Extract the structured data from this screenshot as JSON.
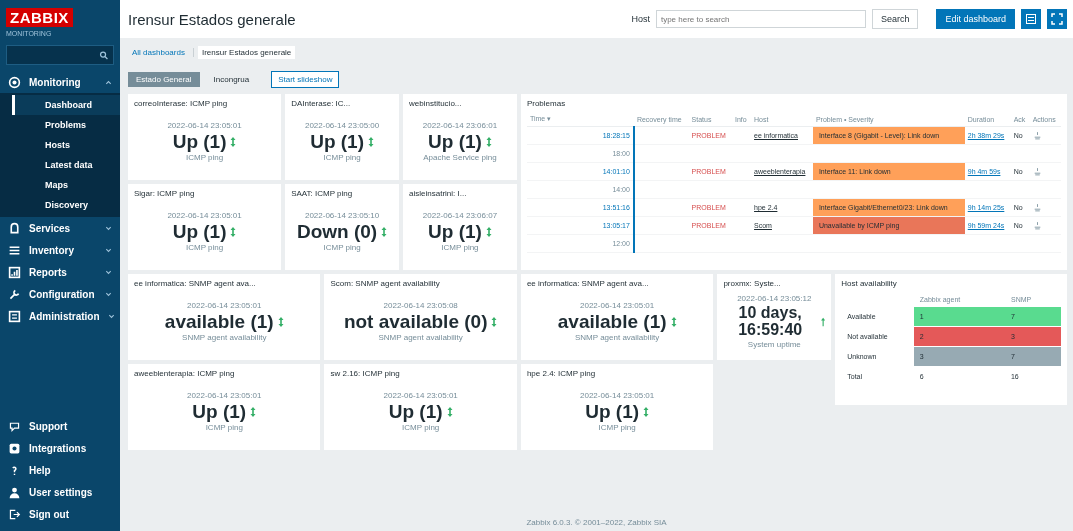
{
  "sidebar": {
    "logo": "ZABBIX",
    "server": "MONITORING",
    "items": [
      {
        "label": "Monitoring",
        "expanded": true,
        "children": [
          {
            "label": "Dashboard",
            "selected": true
          },
          {
            "label": "Problems",
            "selected": false
          },
          {
            "label": "Hosts",
            "selected": false
          },
          {
            "label": "Latest data",
            "selected": false
          },
          {
            "label": "Maps",
            "selected": false
          },
          {
            "label": "Discovery",
            "selected": false
          }
        ]
      },
      {
        "label": "Services",
        "expanded": false
      },
      {
        "label": "Inventory",
        "expanded": false
      },
      {
        "label": "Reports",
        "expanded": false
      },
      {
        "label": "Configuration",
        "expanded": false
      },
      {
        "label": "Administration",
        "expanded": false
      }
    ],
    "bottom": [
      {
        "label": "Support"
      },
      {
        "label": "Integrations"
      },
      {
        "label": "Help"
      },
      {
        "label": "User settings"
      },
      {
        "label": "Sign out"
      }
    ]
  },
  "header": {
    "title": "Irensur Estados generale",
    "host_label": "Host",
    "host_placeholder": "type here to search",
    "search_button": "Search",
    "edit_button": "Edit dashboard"
  },
  "breadcrumbs": [
    "All dashboards",
    "Irensur Estados generale"
  ],
  "pages": [
    {
      "label": "Estado General",
      "selected": true
    },
    {
      "label": "Incongrua",
      "selected": false
    }
  ],
  "slideshow_button": "Start slideshow",
  "widgets": [
    {
      "kind": "item",
      "title": "correoInterase: ICMP ping",
      "time": "2022-06-14 23:05:01",
      "value": "Up (1)",
      "description": "ICMP ping"
    },
    {
      "kind": "item",
      "title": "DAInterase: IC...",
      "time": "2022-06-14 23:05:00",
      "value": "Up (1)",
      "description": "ICMP ping"
    },
    {
      "kind": "item",
      "title": "webinstitucio...",
      "time": "2022-06-14 23:06:01",
      "value": "Up (1)",
      "description": "Apache Service ping"
    },
    {
      "kind": "problems"
    },
    {
      "kind": "item",
      "title": "Sigar: ICMP ping",
      "time": "2022-06-14 23:05:01",
      "value": "Up (1)",
      "description": "ICMP ping"
    },
    {
      "kind": "item",
      "title": "SAAT: ICMP ping",
      "time": "2022-06-14 23:05:10",
      "value": "Down (0)",
      "description": "ICMP ping"
    },
    {
      "kind": "item",
      "title": "aisleinsatrini: I...",
      "time": "2022-06-14 23:06:07",
      "value": "Up (1)",
      "description": "ICMP ping"
    },
    {
      "kind": "item",
      "title": "ee informatica: SNMP agent ava...",
      "time": "2022-06-14 23:05:01",
      "value": "available (1)",
      "description": "SNMP agent availability"
    },
    {
      "kind": "item",
      "title": "Scom: SNMP agent availability",
      "time": "2022-06-14 23:05:08",
      "value": "not available (0)",
      "description": "SNMP agent availability"
    },
    {
      "kind": "item",
      "title": "ee informatica: SNMP agent ava...",
      "time": "2022-06-14 23:05:01",
      "value": "available (1)",
      "description": "SNMP agent availability"
    },
    {
      "kind": "uptime",
      "title": "proxmx: Syste...",
      "time": "2022-06-14 23:05:12",
      "value": "10 days, 16:59:40",
      "description": "System uptime"
    },
    {
      "kind": "hostavail"
    },
    {
      "kind": "item",
      "title": "aweeblenterapia: ICMP ping",
      "time": "2022-06-14 23:05:01",
      "value": "Up (1)",
      "description": "ICMP ping"
    },
    {
      "kind": "item",
      "title": "sw 2.16: ICMP ping",
      "time": "2022-06-14 23:05:01",
      "value": "Up (1)",
      "description": "ICMP ping"
    },
    {
      "kind": "item",
      "title": "hpe 2.4: ICMP ping",
      "time": "2022-06-14 23:05:01",
      "value": "Up (1)",
      "description": "ICMP ping"
    }
  ],
  "problems": {
    "title": "Problemas",
    "columns": [
      "Time ▾",
      "Recovery time",
      "Status",
      "Info",
      "Host",
      "Problem • Severity",
      "Duration",
      "Ack",
      "Actions"
    ],
    "rows": [
      {
        "kind": "problem",
        "time": "18:28:15",
        "status": "PROBLEM",
        "host": "ee informatica",
        "problem": "Interface 8 (Gigabit - Level): Link down",
        "color": "#ffa059",
        "duration": "2h 38m 29s",
        "ack": "No"
      },
      {
        "kind": "marker",
        "time": "18:00"
      },
      {
        "kind": "problem",
        "time": "14:01:10",
        "status": "PROBLEM",
        "host": "aweeblenterapia",
        "problem": "Interface 11: Link down",
        "color": "#ffa059",
        "duration": "9h 4m 59s",
        "ack": "No"
      },
      {
        "kind": "marker",
        "time": "14:00"
      },
      {
        "kind": "problem",
        "time": "13:51:16",
        "status": "PROBLEM",
        "host": "hpe 2.4",
        "problem": "Interface Gigabit/Ethernet0/23: Link down",
        "color": "#ffa059",
        "duration": "9h 14m 25s",
        "ack": "No"
      },
      {
        "kind": "problem",
        "time": "13:05:17",
        "status": "PROBLEM",
        "host": "Scom",
        "problem": "Unavailable by ICMP ping",
        "color": "#e97659",
        "duration": "9h 59m 24s",
        "ack": "No"
      },
      {
        "kind": "marker",
        "time": "12:00"
      }
    ]
  },
  "hostavail": {
    "title": "Host availability",
    "columns": [
      "Zabbix agent",
      "SNMP"
    ],
    "rows": [
      {
        "label": "Available",
        "values": [
          "1",
          "7"
        ],
        "color": "#59db8f"
      },
      {
        "label": "Not available",
        "values": [
          "2",
          "3"
        ],
        "color": "#e45959"
      },
      {
        "label": "Unknown",
        "values": [
          "3",
          "7"
        ],
        "color": "#97aab3"
      },
      {
        "label": "Total",
        "values": [
          "6",
          "16"
        ]
      }
    ]
  },
  "footer": "Zabbix 6.0.3. © 2001–2022, Zabbix SIA"
}
